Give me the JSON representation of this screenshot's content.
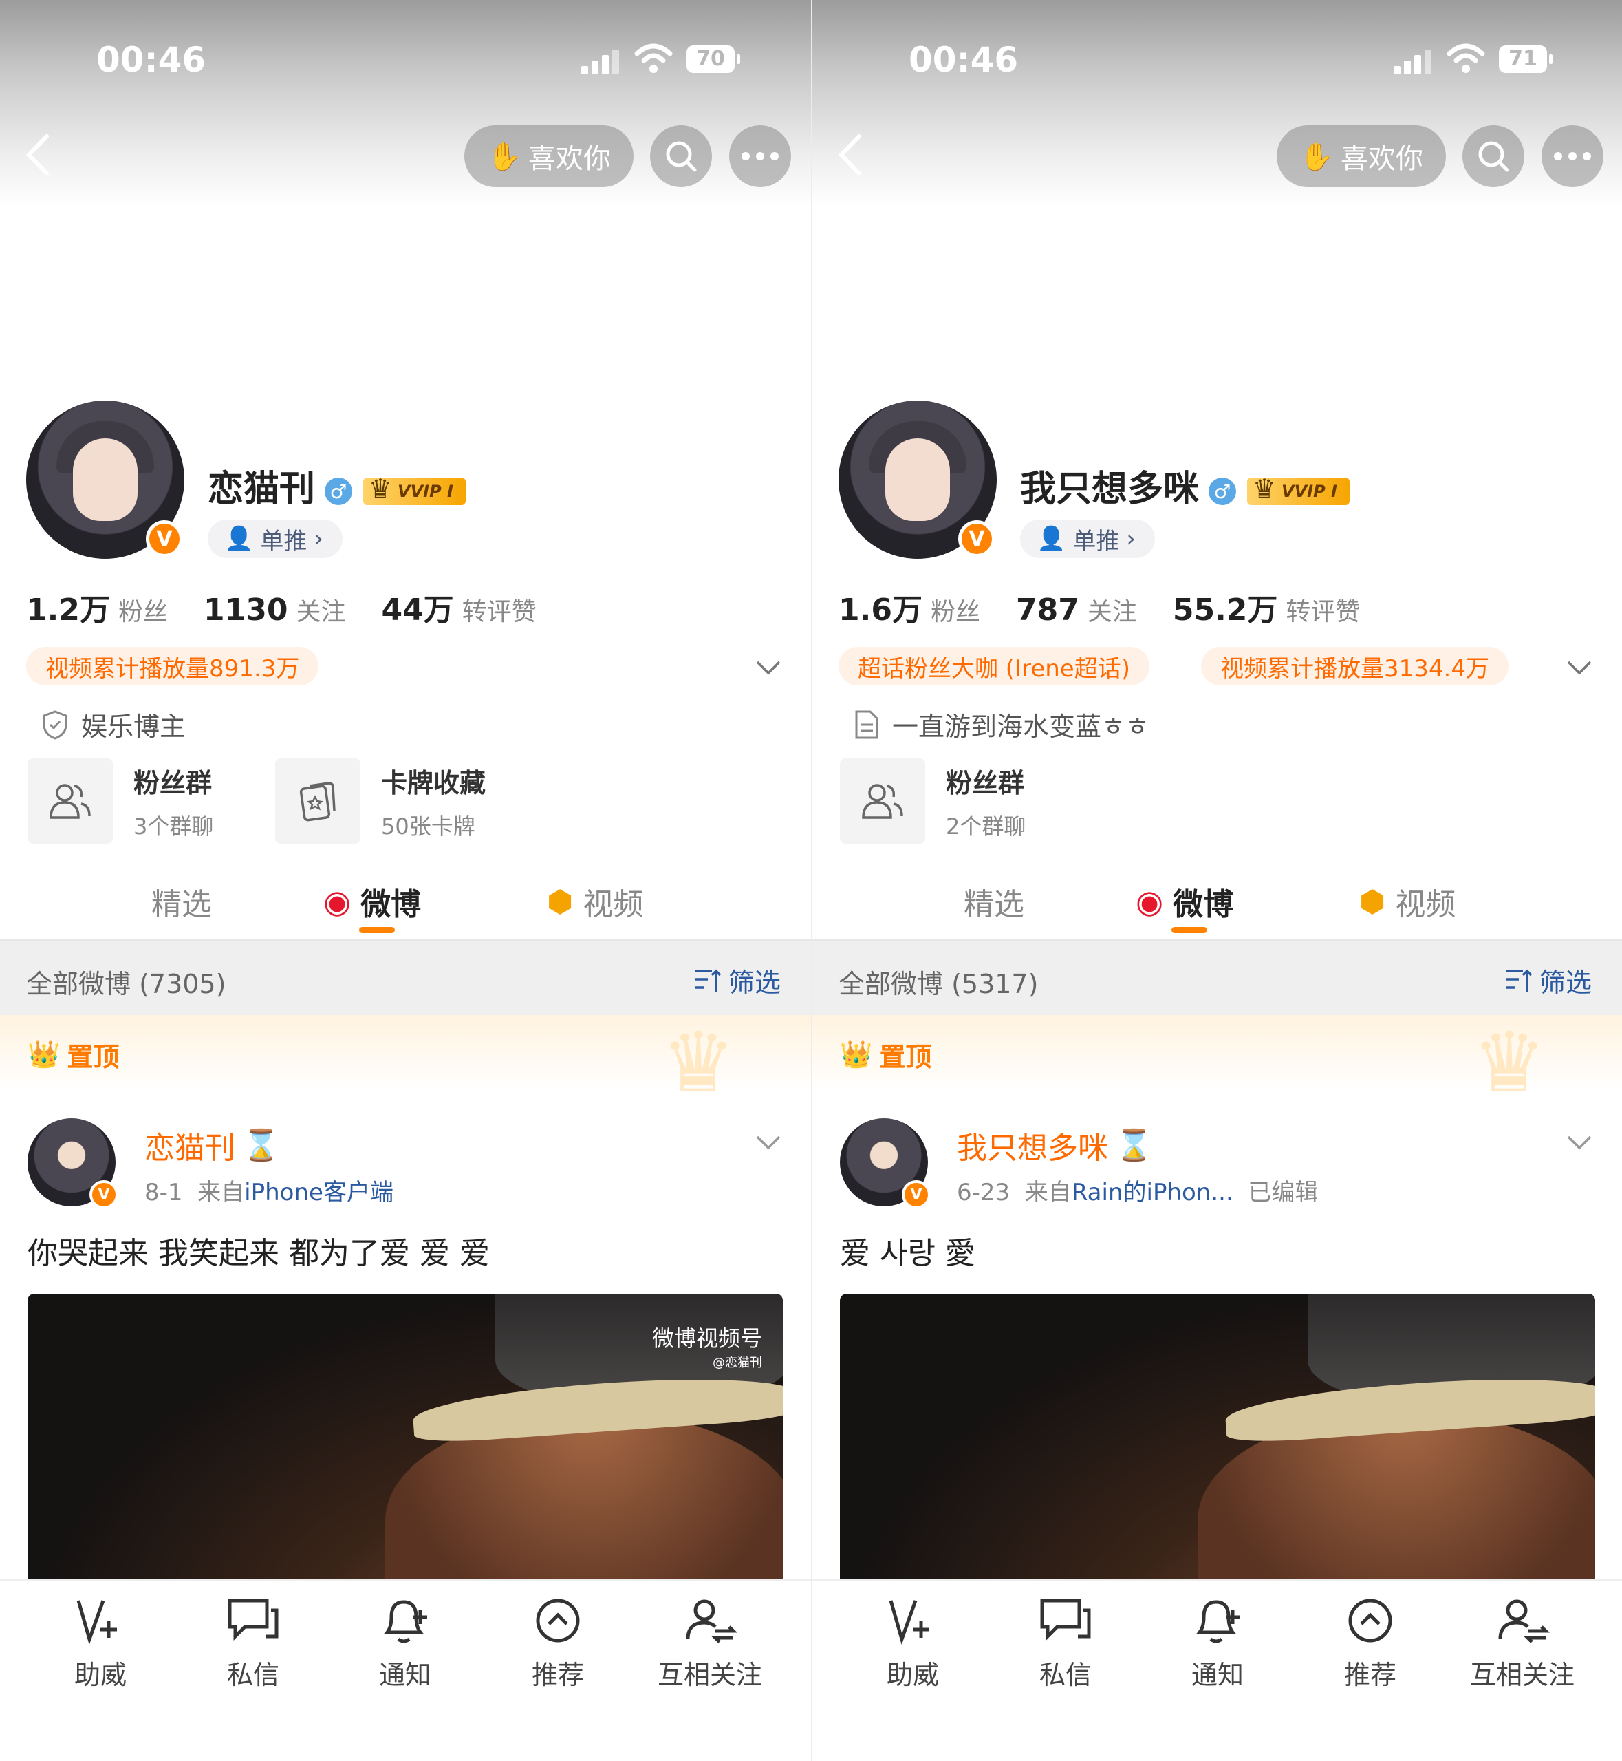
{
  "panels": [
    {
      "status": {
        "time": "00:46",
        "battery": "70"
      },
      "header": {
        "like_label": "喜欢你"
      },
      "profile": {
        "name": "恋猫刊",
        "badge_vvip": "VVIP I",
        "tui_label": "单推",
        "fans": "1.2万",
        "fans_label": "粉丝",
        "follow": "1130",
        "follow_label": "关注",
        "likes": "44万",
        "likes_label": "转评赞",
        "tags": [
          "视频累计播放量891.3万"
        ],
        "desc": "娱乐博主"
      },
      "cards": [
        {
          "title": "粉丝群",
          "sub": "3个群聊"
        },
        {
          "title": "卡牌收藏",
          "sub": "50张卡牌"
        }
      ],
      "tabs": {
        "featured": "精选",
        "weibo": "微博",
        "video": "视频"
      },
      "filter": {
        "count": "全部微博 (7305)",
        "filter_label": "筛选"
      },
      "pinned_label": "置顶",
      "post": {
        "author": "恋猫刊",
        "date": "8-1",
        "from": "来自",
        "source": "iPhone客户端",
        "edited": "",
        "text": "你哭起来 我笑起来 都为了爱 爱 爱",
        "watermark": "微博视频号",
        "watermark_sub": "@恋猫刊"
      }
    },
    {
      "status": {
        "time": "00:46",
        "battery": "71"
      },
      "header": {
        "like_label": "喜欢你"
      },
      "profile": {
        "name": "我只想多咪",
        "badge_vvip": "VVIP I",
        "tui_label": "单推",
        "fans": "1.6万",
        "fans_label": "粉丝",
        "follow": "787",
        "follow_label": "关注",
        "likes": "55.2万",
        "likes_label": "转评赞",
        "tags": [
          "超话粉丝大咖 (Irene超话)",
          "视频累计播放量3134.4万"
        ],
        "desc": "一直游到海水变蓝ㅎㅎ"
      },
      "cards": [
        {
          "title": "粉丝群",
          "sub": "2个群聊"
        }
      ],
      "tabs": {
        "featured": "精选",
        "weibo": "微博",
        "video": "视频"
      },
      "filter": {
        "count": "全部微博 (5317)",
        "filter_label": "筛选"
      },
      "pinned_label": "置顶",
      "post": {
        "author": "我只想多咪",
        "date": "6-23",
        "from": "来自",
        "source": "Rain的iPhon...",
        "edited": "已编辑",
        "text": "爱 사랑 愛",
        "watermark": "",
        "watermark_sub": ""
      }
    }
  ],
  "bottom_bar": {
    "assist": "助威",
    "message": "私信",
    "notify": "通知",
    "recommend": "推荐",
    "mutual": "互相关注"
  },
  "colors": {
    "accent": "#ff8200",
    "link": "#2c5aa0",
    "tag_bg": "#fff1e6"
  }
}
